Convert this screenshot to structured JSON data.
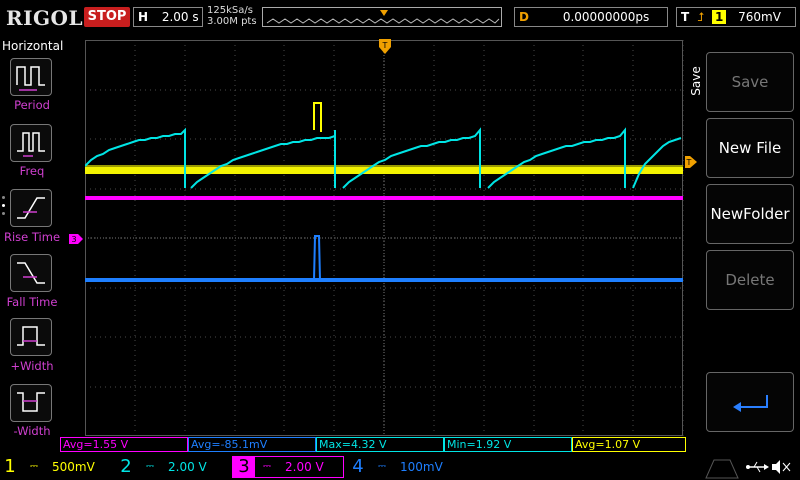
{
  "brand": "RIGOL",
  "run_status": "STOP",
  "timebase": {
    "label": "H",
    "value": "2.00 s"
  },
  "sampling": {
    "rate": "125kSa/s",
    "points": "3.00M pts"
  },
  "delay": {
    "label": "D",
    "value": "0.00000000ps"
  },
  "trigger": {
    "label": "T",
    "channel": "1",
    "level": "760mV"
  },
  "horizontal_menu": {
    "title": "Horizontal",
    "items": [
      {
        "label": "Period",
        "icon": "period-icon"
      },
      {
        "label": "Freq",
        "icon": "freq-icon"
      },
      {
        "label": "Rise Time",
        "icon": "rise-time-icon"
      },
      {
        "label": "Fall Time",
        "icon": "fall-time-icon"
      },
      {
        "label": "+Width",
        "icon": "positive-width-icon"
      },
      {
        "label": "-Width",
        "icon": "negative-width-icon"
      }
    ]
  },
  "save_menu": {
    "tab_label": "Save",
    "buttons": [
      {
        "label": "Save",
        "enabled": false
      },
      {
        "label": "New File",
        "enabled": true
      },
      {
        "label": "NewFolder",
        "enabled": true
      },
      {
        "label": "Delete",
        "enabled": false
      }
    ]
  },
  "measurements": [
    {
      "text": "Avg=1.55 V",
      "color": "#ff00ff"
    },
    {
      "text": "Avg=-85.1mV",
      "color": "#1e7fff"
    },
    {
      "text": "Max=4.32 V",
      "color": "#00e5e5"
    },
    {
      "text": "Min=1.92 V",
      "color": "#00e5e5"
    },
    {
      "text": "Avg=1.07 V",
      "color": "#ffff00"
    }
  ],
  "channels": [
    {
      "num": "1",
      "scale": "500mV",
      "color": "#ffff00",
      "active": false
    },
    {
      "num": "2",
      "scale": "2.00 V",
      "color": "#00e5e5",
      "active": false
    },
    {
      "num": "3",
      "scale": "2.00 V",
      "color": "#ff00ff",
      "active": true
    },
    {
      "num": "4",
      "scale": "100mV",
      "color": "#1e7fff",
      "active": false
    }
  ],
  "colors": {
    "ch1": "#ffff00",
    "ch2": "#00e5e5",
    "ch3": "#ff00ff",
    "ch4": "#1e7fff",
    "trigger": "#f0a000",
    "stop": "#c81e1e"
  }
}
